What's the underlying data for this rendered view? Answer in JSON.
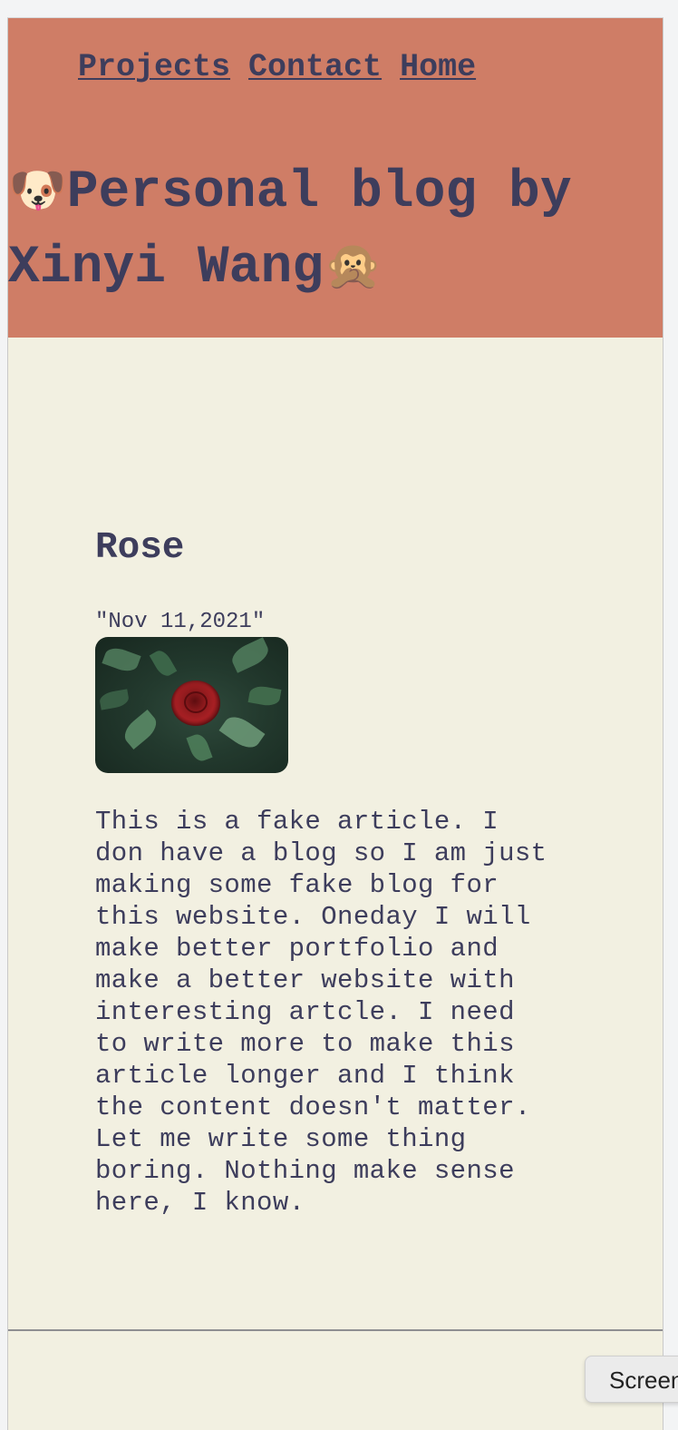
{
  "nav": {
    "items": [
      {
        "label": "Projects"
      },
      {
        "label": "Contact"
      },
      {
        "label": "Home"
      }
    ]
  },
  "header": {
    "title_emoji_left": "🐶",
    "title_text": "Personal blog by Xinyi Wang",
    "title_emoji_right": "🙊"
  },
  "article": {
    "title": "Rose",
    "date": "\"Nov 11,2021\"",
    "image_icon": "rose-photo",
    "body": "This is a fake article. I\ndon have a blog so I am just\nmaking some fake blog for\nthis website. Oneday I will\nmake better portfolio and\nmake a better website with\ninteresting artcle. I need\nto write more to make this\narticle longer and I think\nthe content doesn't matter.\nLet me write some thing\nboring. Nothing make sense\nhere, I know."
  },
  "floating_button": {
    "label": "Screenshot"
  },
  "colors": {
    "header_bg": "#cf7d66",
    "page_bg": "#f2f0e1",
    "text": "#3d3d5c"
  }
}
